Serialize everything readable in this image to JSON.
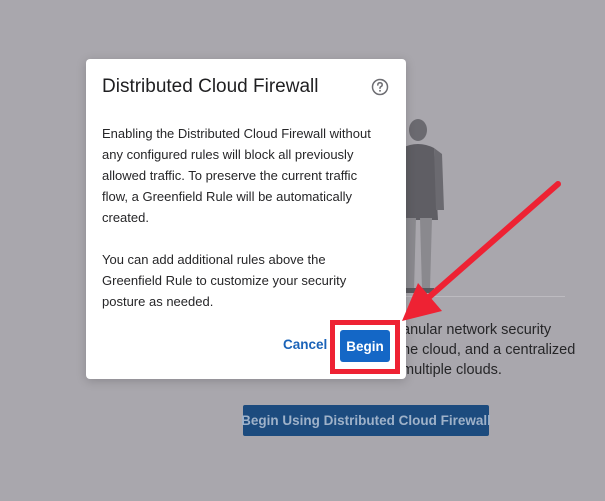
{
  "background": {
    "description_lines": [
      "anular network security",
      "he cloud, and a centralized",
      "multiple clouds."
    ],
    "cta_button_label": "Begin Using Distributed Cloud Firewall"
  },
  "modal": {
    "title": "Distributed Cloud Firewall",
    "help_icon": "question-circle-icon",
    "body": {
      "paragraph1_lines": [
        "Enabling the Distributed Cloud Firewall without",
        "any configured rules will block all previously",
        "allowed traffic. To preserve the current traffic",
        "flow, a Greenfield Rule will be automatically",
        "created."
      ],
      "paragraph2_lines": [
        "You can add additional rules above the",
        "Greenfield Rule to customize your security",
        "posture as needed."
      ]
    },
    "cancel_label": "Cancel",
    "begin_label": "Begin"
  },
  "annotation": {
    "color": "#ee2233"
  }
}
